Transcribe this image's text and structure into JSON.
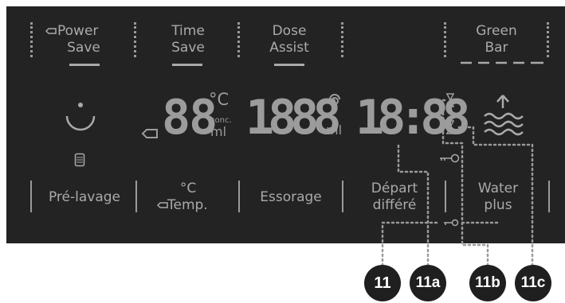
{
  "top_buttons": {
    "power_save": [
      "Power",
      "Save"
    ],
    "time_save": [
      "Time",
      "Save"
    ],
    "dose_assist": [
      "Dose",
      "Assist"
    ],
    "green_bar": [
      "Green",
      "Bar"
    ]
  },
  "display": {
    "temp_digits": "88",
    "temp_unit": "°C",
    "conc_label": "conc.",
    "temp_ml": "ml",
    "dose_digits": "1888",
    "dose_ml": "ml",
    "time_digits": "18:88"
  },
  "bottom_buttons": {
    "prelavage": "Pré-lavage",
    "temp_top": "°C",
    "temp_bottom": "Temp.",
    "essorage": "Essorage",
    "depart_top": "Départ",
    "depart_bottom": "différé",
    "water_top": "Water",
    "water_bottom": "plus"
  },
  "callouts": [
    "11",
    "11a",
    "11b",
    "11c"
  ],
  "colors": {
    "panel": "#232323",
    "segment": "#9c9c9c",
    "callout_bg": "#1f1f1f"
  }
}
